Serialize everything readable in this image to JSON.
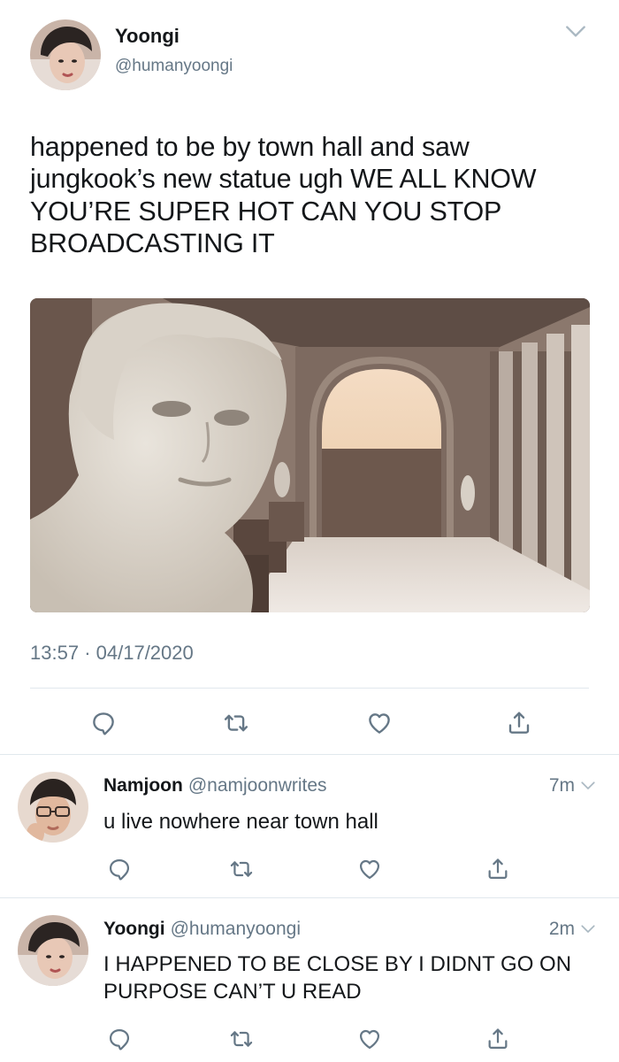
{
  "main_tweet": {
    "author_name": "Yoongi",
    "author_handle": "@humanyoongi",
    "text": "happened to be by town hall and saw jungkook’s new statue ugh WE ALL KNOW YOU’RE SUPER HOT CAN YOU STOP BROADCASTING IT",
    "time": "13:57",
    "separator": "·",
    "date": "04/17/2020"
  },
  "replies": [
    {
      "name": "Namjoon",
      "handle": "@namjoonwrites",
      "time_ago": "7m",
      "text": "u live nowhere near town hall"
    },
    {
      "name": "Yoongi",
      "handle": "@humanyoongi",
      "time_ago": "2m",
      "text": "I HAPPENED TO BE CLOSE BY I DIDNT GO ON PURPOSE CAN’T U READ"
    }
  ],
  "icons": {
    "reply": "reply-icon",
    "retweet": "retweet-icon",
    "like": "like-icon",
    "share": "share-icon",
    "more": "chevron-down-icon"
  },
  "colors": {
    "text": "#14171a",
    "secondary": "#657786",
    "divider": "#e1e8ed"
  }
}
